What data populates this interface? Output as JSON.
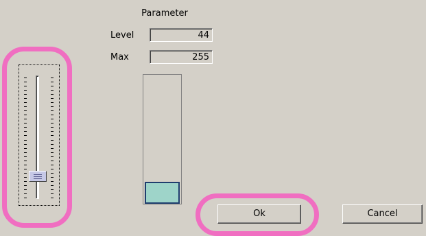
{
  "dialog": {
    "title": "Parameter",
    "level_label": "Level",
    "level_value": "44",
    "max_label": "Max",
    "max_value": "255"
  },
  "slider": {
    "value": 44,
    "max": 255
  },
  "level_bar": {
    "fraction": 0.1725
  },
  "buttons": {
    "ok_label": "Ok",
    "cancel_label": "Cancel"
  },
  "colors": {
    "background": "#d4d0c8",
    "bar_fill": "#9ed4c9",
    "bar_border": "#1f3d6e",
    "thumb": "#c6c8e6",
    "highlight": "#f06ec1"
  }
}
